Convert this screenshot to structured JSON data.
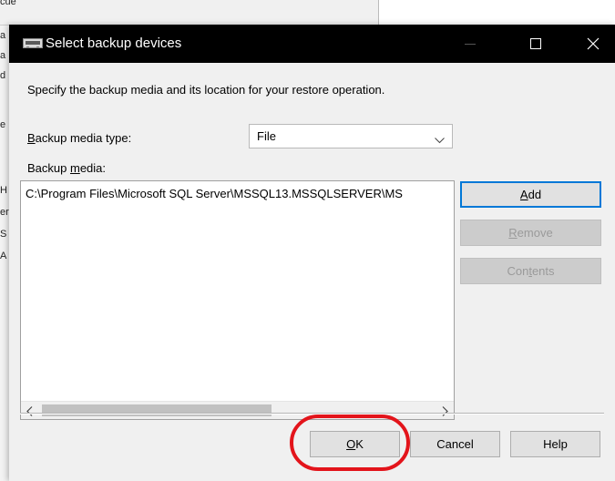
{
  "background": {
    "fragments": [
      "cue",
      "a",
      "a",
      "d",
      "e",
      "H",
      "er",
      "S",
      "A"
    ]
  },
  "dialog": {
    "title": "Select backup devices",
    "icon": "backup-device-icon",
    "titlebar_buttons": [
      "minimize-icon",
      "maximize-icon",
      "close-icon"
    ],
    "instructions": "Specify the backup media and its location for your restore operation.",
    "media_type": {
      "label_mnemonic": "B",
      "label_rest": "ackup media type:",
      "value": "File"
    },
    "media": {
      "label_prefix": "Backup ",
      "label_mnemonic": "m",
      "label_rest": "edia:",
      "items": [
        "C:\\Program Files\\Microsoft SQL Server\\MSSQL13.MSSQLSERVER\\MS"
      ]
    },
    "side_buttons": {
      "add": {
        "mnemonic": "A",
        "rest": "dd"
      },
      "remove": {
        "mnemonic": "R",
        "rest": "emove"
      },
      "contents": {
        "pre": "Con",
        "mnemonic": "t",
        "rest": "ents"
      }
    },
    "footer_buttons": {
      "ok": {
        "mnemonic": "O",
        "rest": "K"
      },
      "cancel": "Cancel",
      "help": "Help"
    }
  },
  "colors": {
    "titlebar": "#000000",
    "dialog_bg": "#f0f0f0",
    "focus_border": "#0078d7",
    "annotation": "#e3141b"
  }
}
